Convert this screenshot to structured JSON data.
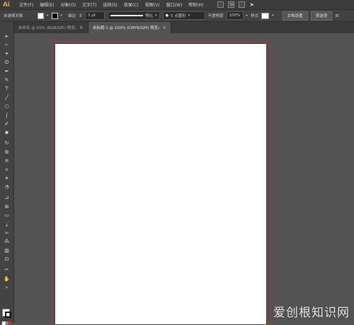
{
  "app": {
    "logo": "Ai"
  },
  "menu": [
    "文件(F)",
    "编辑(E)",
    "对象(O)",
    "文字(T)",
    "选择(S)",
    "效果(C)",
    "视图(V)",
    "窗口(W)",
    "帮助(H)"
  ],
  "menubar_right": {
    "workspace_badge": "St"
  },
  "control": {
    "selection_label": "未选择对象",
    "stroke_label": "描边",
    "stroke_value": "1 pt",
    "profile_label": "等比",
    "brush_label": "5 点圆形",
    "opacity_label": "不透明度",
    "opacity_value": "100%",
    "style_label": "样式",
    "doc_setup_button": "文档设置",
    "preferences_button": "首选项"
  },
  "tabs": [
    {
      "label": "未命名 @ 50% (RGB/GPU 预览)",
      "close": "×",
      "active": false
    },
    {
      "label": "未标题-1 @ 100% (CMYK/GPU 预览)",
      "close": "×",
      "active": true
    }
  ],
  "tools": [
    {
      "name": "selection-tool-icon",
      "glyph": "▸"
    },
    {
      "name": "direct-selection-tool-icon",
      "glyph": "▹"
    },
    {
      "name": "magic-wand-tool-icon",
      "glyph": "✦"
    },
    {
      "name": "lasso-tool-icon",
      "glyph": "ʘ"
    },
    {
      "name": "pen-tool-icon",
      "glyph": "✒"
    },
    {
      "name": "curvature-tool-icon",
      "glyph": "✎"
    },
    {
      "name": "type-tool-icon",
      "glyph": "T"
    },
    {
      "name": "line-tool-icon",
      "glyph": "╱"
    },
    {
      "name": "ellipse-tool-icon",
      "glyph": "○"
    },
    {
      "name": "paintbrush-tool-icon",
      "glyph": "ʃ"
    },
    {
      "name": "pencil-tool-icon",
      "glyph": "✐"
    },
    {
      "name": "eraser-tool-icon",
      "glyph": "◆"
    },
    {
      "name": "rotate-tool-icon",
      "glyph": "↻"
    },
    {
      "name": "scale-tool-icon",
      "glyph": "⧉"
    },
    {
      "name": "warp-tool-icon",
      "glyph": "≋"
    },
    {
      "name": "free-transform-tool-icon",
      "glyph": "⌗"
    },
    {
      "name": "puppet-warp-tool-icon",
      "glyph": "✶"
    },
    {
      "name": "shape-builder-tool-icon",
      "glyph": "◔"
    },
    {
      "name": "perspective-grid-tool-icon",
      "glyph": "⊿"
    },
    {
      "name": "mesh-tool-icon",
      "glyph": "⊞"
    },
    {
      "name": "gradient-tool-icon",
      "glyph": "▭"
    },
    {
      "name": "eyedropper-tool-icon",
      "glyph": "⤓"
    },
    {
      "name": "blend-tool-icon",
      "glyph": "∞"
    },
    {
      "name": "symbol-sprayer-tool-icon",
      "glyph": "⁂"
    },
    {
      "name": "column-graph-tool-icon",
      "glyph": "▥"
    },
    {
      "name": "artboard-tool-icon",
      "glyph": "⊡"
    },
    {
      "name": "slice-tool-icon",
      "glyph": "✂"
    },
    {
      "name": "hand-tool-icon",
      "glyph": "✋"
    },
    {
      "name": "zoom-tool-icon",
      "glyph": "⌕"
    }
  ],
  "colors": {
    "artboard": "#ffffff",
    "bleed": "#c03030",
    "ui_dark": "#3c3c3c",
    "canvas": "#535353"
  },
  "watermark": "爱创根知识网"
}
